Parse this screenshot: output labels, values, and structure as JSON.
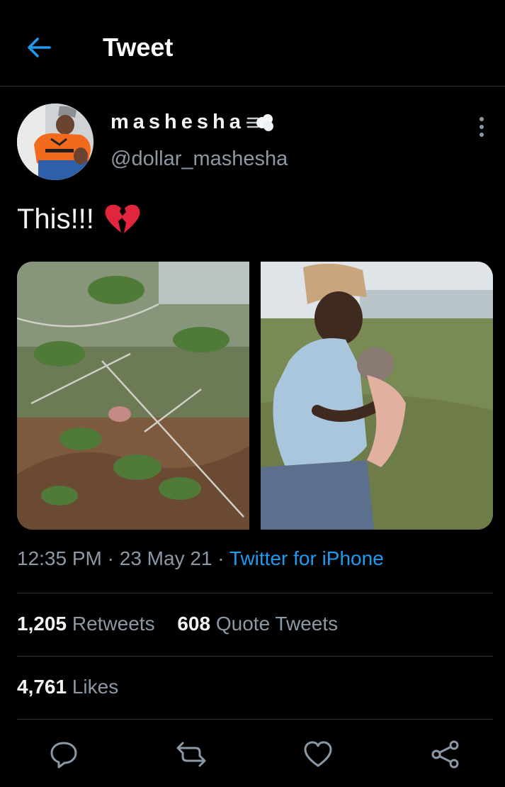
{
  "header": {
    "title": "Tweet"
  },
  "author": {
    "display_name": "mashesha",
    "handle": "@dollar_mashesha"
  },
  "tweet": {
    "text": "This!!!",
    "emoji": "💔",
    "time": "12:35 PM",
    "date": "23 May 21",
    "source": "Twitter for iPhone",
    "separator": "·"
  },
  "stats": {
    "retweets_count": "1,205",
    "retweets_label": "Retweets",
    "quotes_count": "608",
    "quotes_label": "Quote Tweets",
    "likes_count": "4,761",
    "likes_label": "Likes"
  },
  "colors": {
    "accent": "#1d9bf0",
    "background": "#000000",
    "secondary_text": "#8b98a5",
    "divider": "#2f3336"
  },
  "icons": {
    "back": "arrow-left-icon",
    "more": "more-vertical-icon",
    "reply": "reply-icon",
    "retweet": "retweet-icon",
    "like": "heart-icon",
    "share": "share-icon"
  }
}
